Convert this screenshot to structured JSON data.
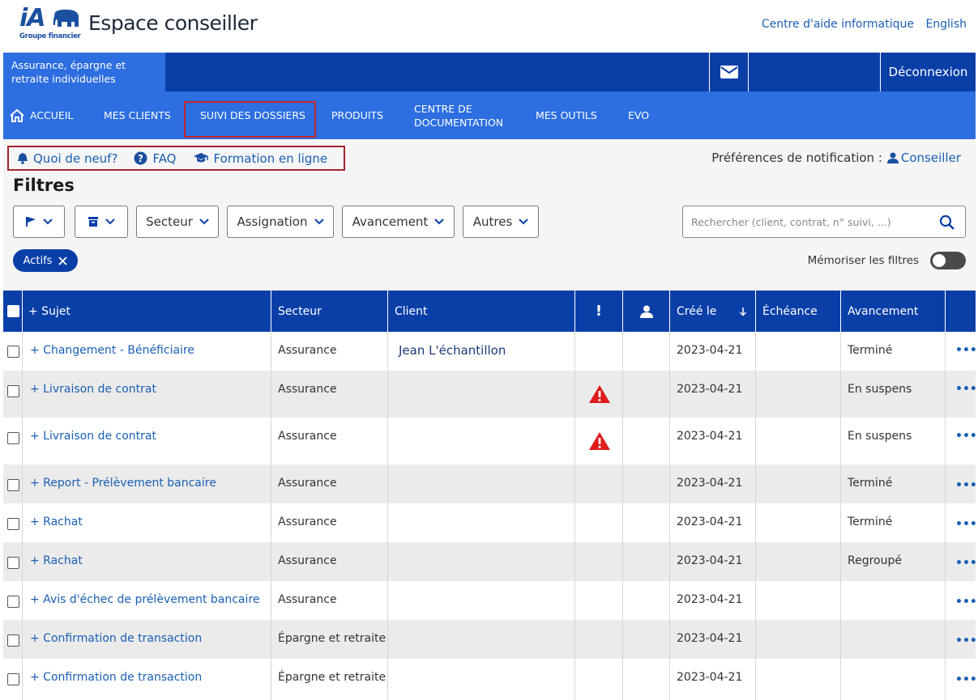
{
  "header": {
    "logo_text": "iA",
    "logo_sub": "Groupe financier",
    "title": "Espace conseiller",
    "links": [
      "Centre d'aide informatique",
      "English"
    ]
  },
  "bar": {
    "sector": "Assurance, épargne et retraite individuelles",
    "logout": "Déconnexion"
  },
  "nav": {
    "items": [
      "ACCUEIL",
      "MES CLIENTS",
      "SUIVI DES DOSSIERS",
      "PRODUITS",
      "CENTRE DE DOCUMENTATION",
      "MES OUTILS",
      "EVO"
    ]
  },
  "quick": {
    "news": "Quoi de neuf?",
    "faq": "FAQ",
    "training": "Formation en ligne"
  },
  "pref": {
    "label": "Préférences de notification :",
    "link": "Conseiller"
  },
  "filters": {
    "title": "Filtres",
    "buttons": [
      "Secteur",
      "Assignation",
      "Avancement",
      "Autres"
    ],
    "search_placeholder": "Rechercher (client, contrat, n° suivi, ...)",
    "chip": "Actifs",
    "memo": "Mémoriser les filtres"
  },
  "table": {
    "headers": {
      "subject": "+ Sujet",
      "sector": "Secteur",
      "client": "Client",
      "alert": "!",
      "created": "Créé le",
      "due": "Échéance",
      "progress": "Avancement"
    },
    "rows": [
      {
        "subject": "+ Changement - Bénéficiaire",
        "sector": "Assurance",
        "client": "Jean L'échantillon",
        "alert": false,
        "created": "2023-04-21",
        "due": "",
        "progress": "Terminé"
      },
      {
        "subject": "+ Livraison de contrat",
        "sector": "Assurance",
        "client": "",
        "alert": true,
        "created": "2023-04-21",
        "due": "",
        "progress": "En suspens"
      },
      {
        "subject": "+ Livraison de contrat",
        "sector": "Assurance",
        "client": "",
        "alert": true,
        "created": "2023-04-21",
        "due": "",
        "progress": "En suspens"
      },
      {
        "subject": "+ Report - Prélèvement bancaire",
        "sector": "Assurance",
        "client": "",
        "alert": false,
        "created": "2023-04-21",
        "due": "",
        "progress": "Terminé"
      },
      {
        "subject": "+ Rachat",
        "sector": "Assurance",
        "client": "",
        "alert": false,
        "created": "2023-04-21",
        "due": "",
        "progress": "Terminé"
      },
      {
        "subject": "+ Rachat",
        "sector": "Assurance",
        "client": "",
        "alert": false,
        "created": "2023-04-21",
        "due": "",
        "progress": "Regroupé"
      },
      {
        "subject": "+ Avis d'échec de prélèvement bancaire",
        "sector": "Assurance",
        "client": "",
        "alert": false,
        "created": "2023-04-21",
        "due": "",
        "progress": ""
      },
      {
        "subject": "+ Confirmation de transaction",
        "sector": "Épargne et retraite",
        "client": "",
        "alert": false,
        "created": "2023-04-21",
        "due": "",
        "progress": ""
      },
      {
        "subject": "+ Confirmation de transaction",
        "sector": "Épargne et retraite",
        "client": "",
        "alert": false,
        "created": "2023-04-21",
        "due": "",
        "progress": ""
      }
    ]
  }
}
